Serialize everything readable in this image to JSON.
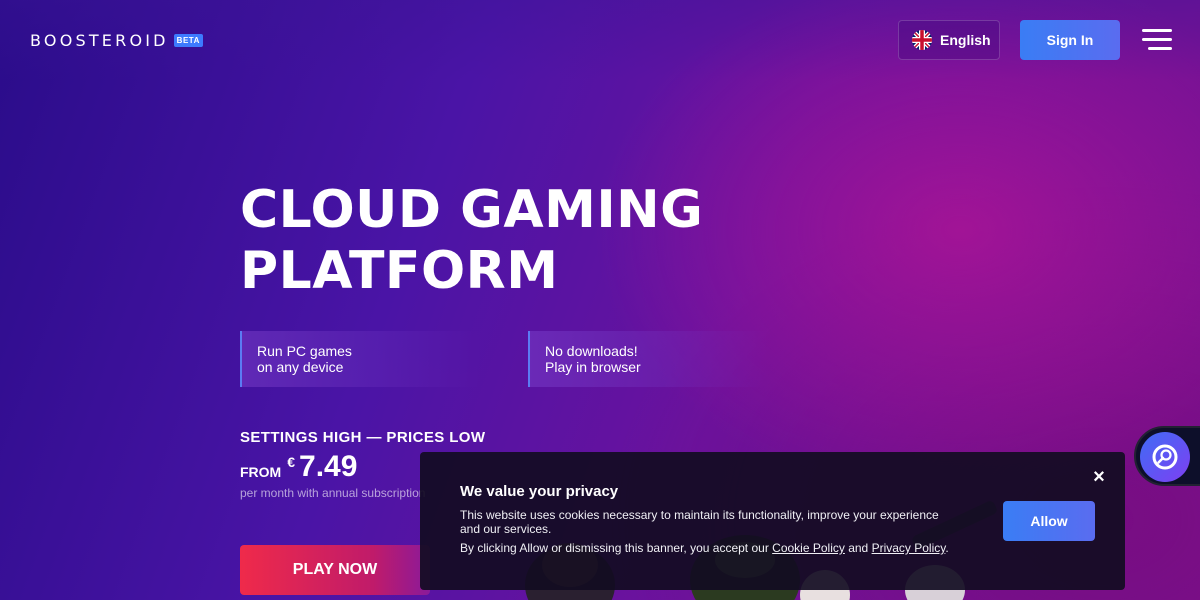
{
  "header": {
    "logo_text": "BOOSTEROID",
    "logo_badge": "BETA",
    "language_label": "English",
    "signin_label": "Sign In",
    "menu_icon": "hamburger-menu-icon"
  },
  "hero": {
    "title_line1": "CLOUD GAMING",
    "title_line2": "PLATFORM",
    "features": [
      {
        "line1": "Run PC games",
        "line2": "on any device"
      },
      {
        "line1": "No downloads!",
        "line2": "Play in browser"
      }
    ],
    "tagline": "SETTINGS HIGH — PRICES LOW",
    "price_from": "FROM",
    "price_currency": "€",
    "price_amount": "7.49",
    "price_note": "per month with annual subscription",
    "play_label": "PLAY NOW"
  },
  "cookie_banner": {
    "title": "We value your privacy",
    "text": "This website uses cookies necessary to maintain its functionality, improve your experience and our services.",
    "consent_prefix": "By clicking Allow or dismissing this banner, you accept our ",
    "cookie_policy_link": "Cookie Policy",
    "and_text": " and ",
    "privacy_policy_link": "Privacy Policy",
    "period": ".",
    "allow_label": "Allow",
    "close_symbol": "×"
  },
  "chat_widget": {
    "icon": "support-chat-icon"
  },
  "colors": {
    "accent_blue": "#3a7df4",
    "play_red": "#ef2a4a",
    "bg_purple": "#4a14a6"
  }
}
